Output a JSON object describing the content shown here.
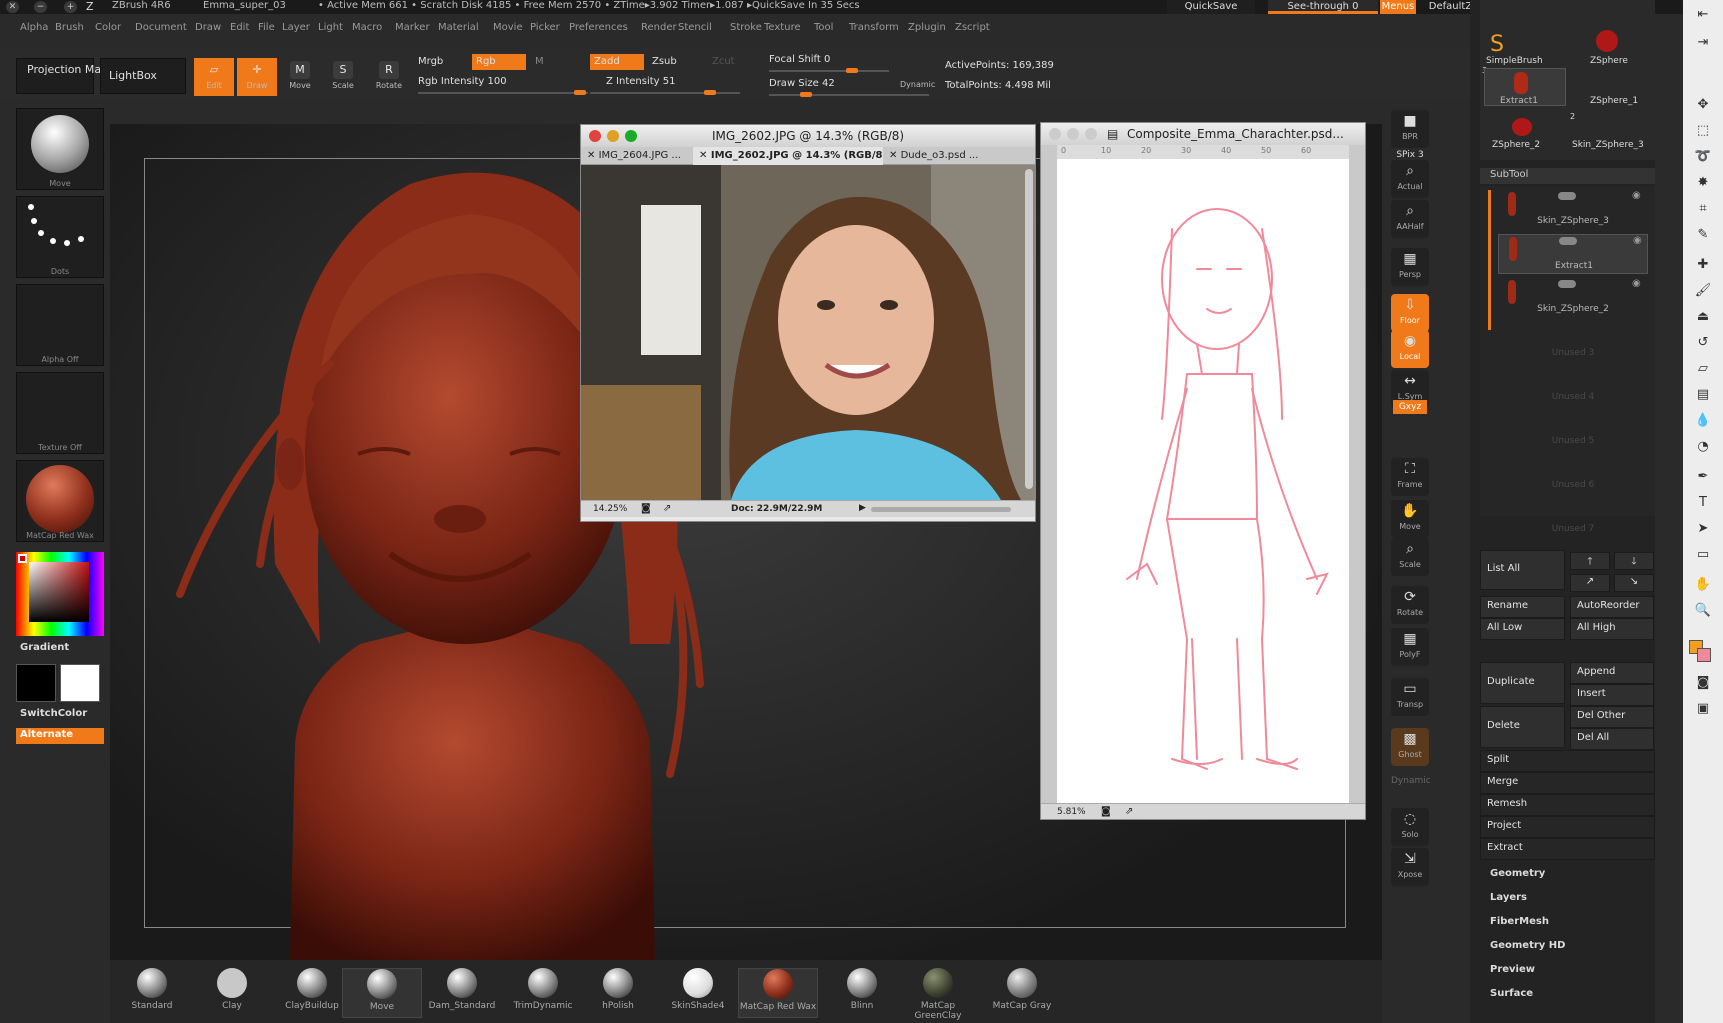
{
  "titlebar": {
    "app": "ZBrush 4R6",
    "file": "Emma_super_03",
    "status": "• Active Mem 661 • Scratch Disk 4185 • Free Mem 2570 • ZTime▸3.902 Timer▸1.087 ▸QuickSave In 35 Secs",
    "quicksave": "QuickSave",
    "seethrough": "See-through  0",
    "menus": "Menus",
    "script": "DefaultZScript"
  },
  "menu": [
    "Alpha",
    "Brush",
    "Color",
    "Document",
    "Draw",
    "Edit",
    "File",
    "Layer",
    "Light",
    "Macro",
    "Marker",
    "Material",
    "Movie",
    "Picker",
    "Preferences",
    "Render",
    "Stencil",
    "Stroke",
    "Texture",
    "Tool",
    "Transform",
    "Zplugin",
    "Zscript"
  ],
  "toolbar": {
    "projection_master": "Projection Master",
    "lightbox": "LightBox",
    "edit": "Edit",
    "draw": "Draw",
    "move": "Move",
    "scale": "Scale",
    "rotate": "Rotate",
    "mrgb": "Mrgb",
    "rgb": "Rgb",
    "m": "M",
    "rgb_intensity": "Rgb Intensity 100",
    "zadd": "Zadd",
    "zsub": "Zsub",
    "zcut": "Zcut",
    "z_intensity": "Z Intensity 51",
    "focal_shift": "Focal Shift 0",
    "draw_size": "Draw Size 42",
    "dynamic": "Dynamic",
    "active_points": "ActivePoints: 169,389",
    "total_points": "TotalPoints: 4.498 Mil"
  },
  "leftshelf": {
    "brush_label": "Move",
    "stroke_label": "Dots",
    "alpha_label": "Alpha  Off",
    "texture_label": "Texture  Off",
    "material_label": "MatCap  Red  Wax",
    "gradient": "Gradient",
    "switchcolor": "SwitchColor",
    "alternate": "Alternate"
  },
  "rightshelf": [
    "BPR",
    "SPix 3",
    "Actual",
    "AAHalf",
    "Persp",
    "Floor",
    "Local",
    "L.Sym",
    "Gxyz",
    "Frame",
    "Move",
    "Scale",
    "Rotate",
    "PolyF",
    "Transp",
    "Ghost",
    "Dynamic",
    "Solo",
    "Xpose"
  ],
  "bottom_materials": [
    "Standard",
    "Clay",
    "ClayBuildup",
    "Move",
    "Dam_Standard",
    "TrimDynamic",
    "hPolish",
    "SkinShade4",
    "MatCap  Red  Wax",
    "Blinn",
    "MatCap  GreenClay",
    "MatCap  Gray"
  ],
  "tool_palette": {
    "top_items": [
      "SimpleBrush",
      "ZSphere",
      "Extract1",
      "ZSphere_1",
      "ZSphere_2",
      "Skin_ZSphere_3"
    ],
    "top_numbers": [
      "3",
      "2"
    ],
    "subtool_header": "SubTool",
    "subtools": [
      "Skin_ZSphere_3",
      "Extract1",
      "Skin_ZSphere_2",
      "Unused  3",
      "Unused  4",
      "Unused  5",
      "Unused  6",
      "Unused  7"
    ],
    "list_all": "List  All",
    "rename": "Rename",
    "autoreorder": "AutoReorder",
    "all_low": "All  Low",
    "all_high": "All  High",
    "duplicate": "Duplicate",
    "append": "Append",
    "insert": "Insert",
    "delete": "Delete",
    "del_other": "Del  Other",
    "del_all": "Del  All",
    "split": "Split",
    "merge": "Merge",
    "remesh": "Remesh",
    "project": "Project",
    "extract": "Extract",
    "sections": [
      "Geometry",
      "Layers",
      "FiberMesh",
      "Geometry  HD",
      "Preview",
      "Surface"
    ]
  },
  "ps_window1": {
    "title": "IMG_2602.JPG @ 14.3% (RGB/8)",
    "tabs": [
      "IMG_2604.JPG ...",
      "IMG_2602.JPG @ 14.3% (RGB/8)",
      "Dude_o3.psd ..."
    ],
    "zoom": "14.25%",
    "doc": "Doc: 22.9M/22.9M"
  },
  "ps_window2": {
    "title": "Composite_Emma_Charachter.psd...",
    "ruler": [
      "0",
      "10",
      "20",
      "30",
      "40",
      "50",
      "60"
    ],
    "zoom": "5.81%"
  },
  "colors": {
    "accent": "#f07a1a",
    "clay": "#8e2f1c",
    "sketch": "#f08a9a"
  }
}
